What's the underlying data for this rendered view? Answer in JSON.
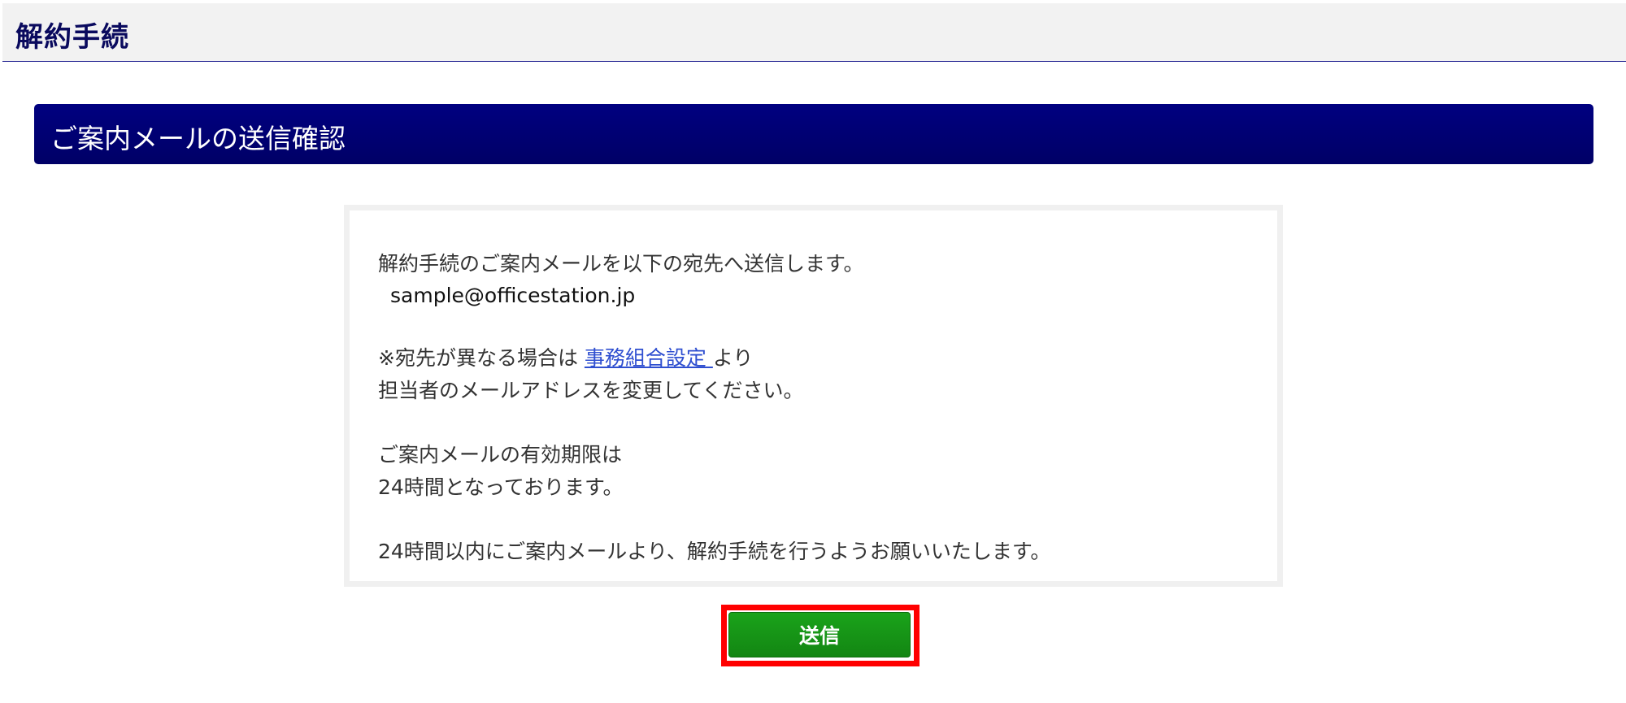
{
  "header": {
    "title": "解約手続"
  },
  "section": {
    "title": "ご案内メールの送信確認"
  },
  "message": {
    "line1": "解約手続のご案内メールを以下の宛先へ送信します。",
    "email": "sample@officestation.jp",
    "note_prefix": "※宛先が異なる場合は ",
    "note_link": "事務組合設定 ",
    "note_suffix": "より",
    "note_line2": "担当者のメールアドレスを変更してください。",
    "validity_line1": "ご案内メールの有効期限は",
    "validity_line2": "24時間となっております。",
    "request_line": "24時間以内にご案内メールより、解約手続を行うようお願いいたします。"
  },
  "actions": {
    "send_label": "送信"
  },
  "colors": {
    "header_title": "#0a0a5e",
    "section_bar": "#000080",
    "link": "#2f4fd0",
    "send_button": "#138613",
    "highlight": "#ff0000"
  }
}
